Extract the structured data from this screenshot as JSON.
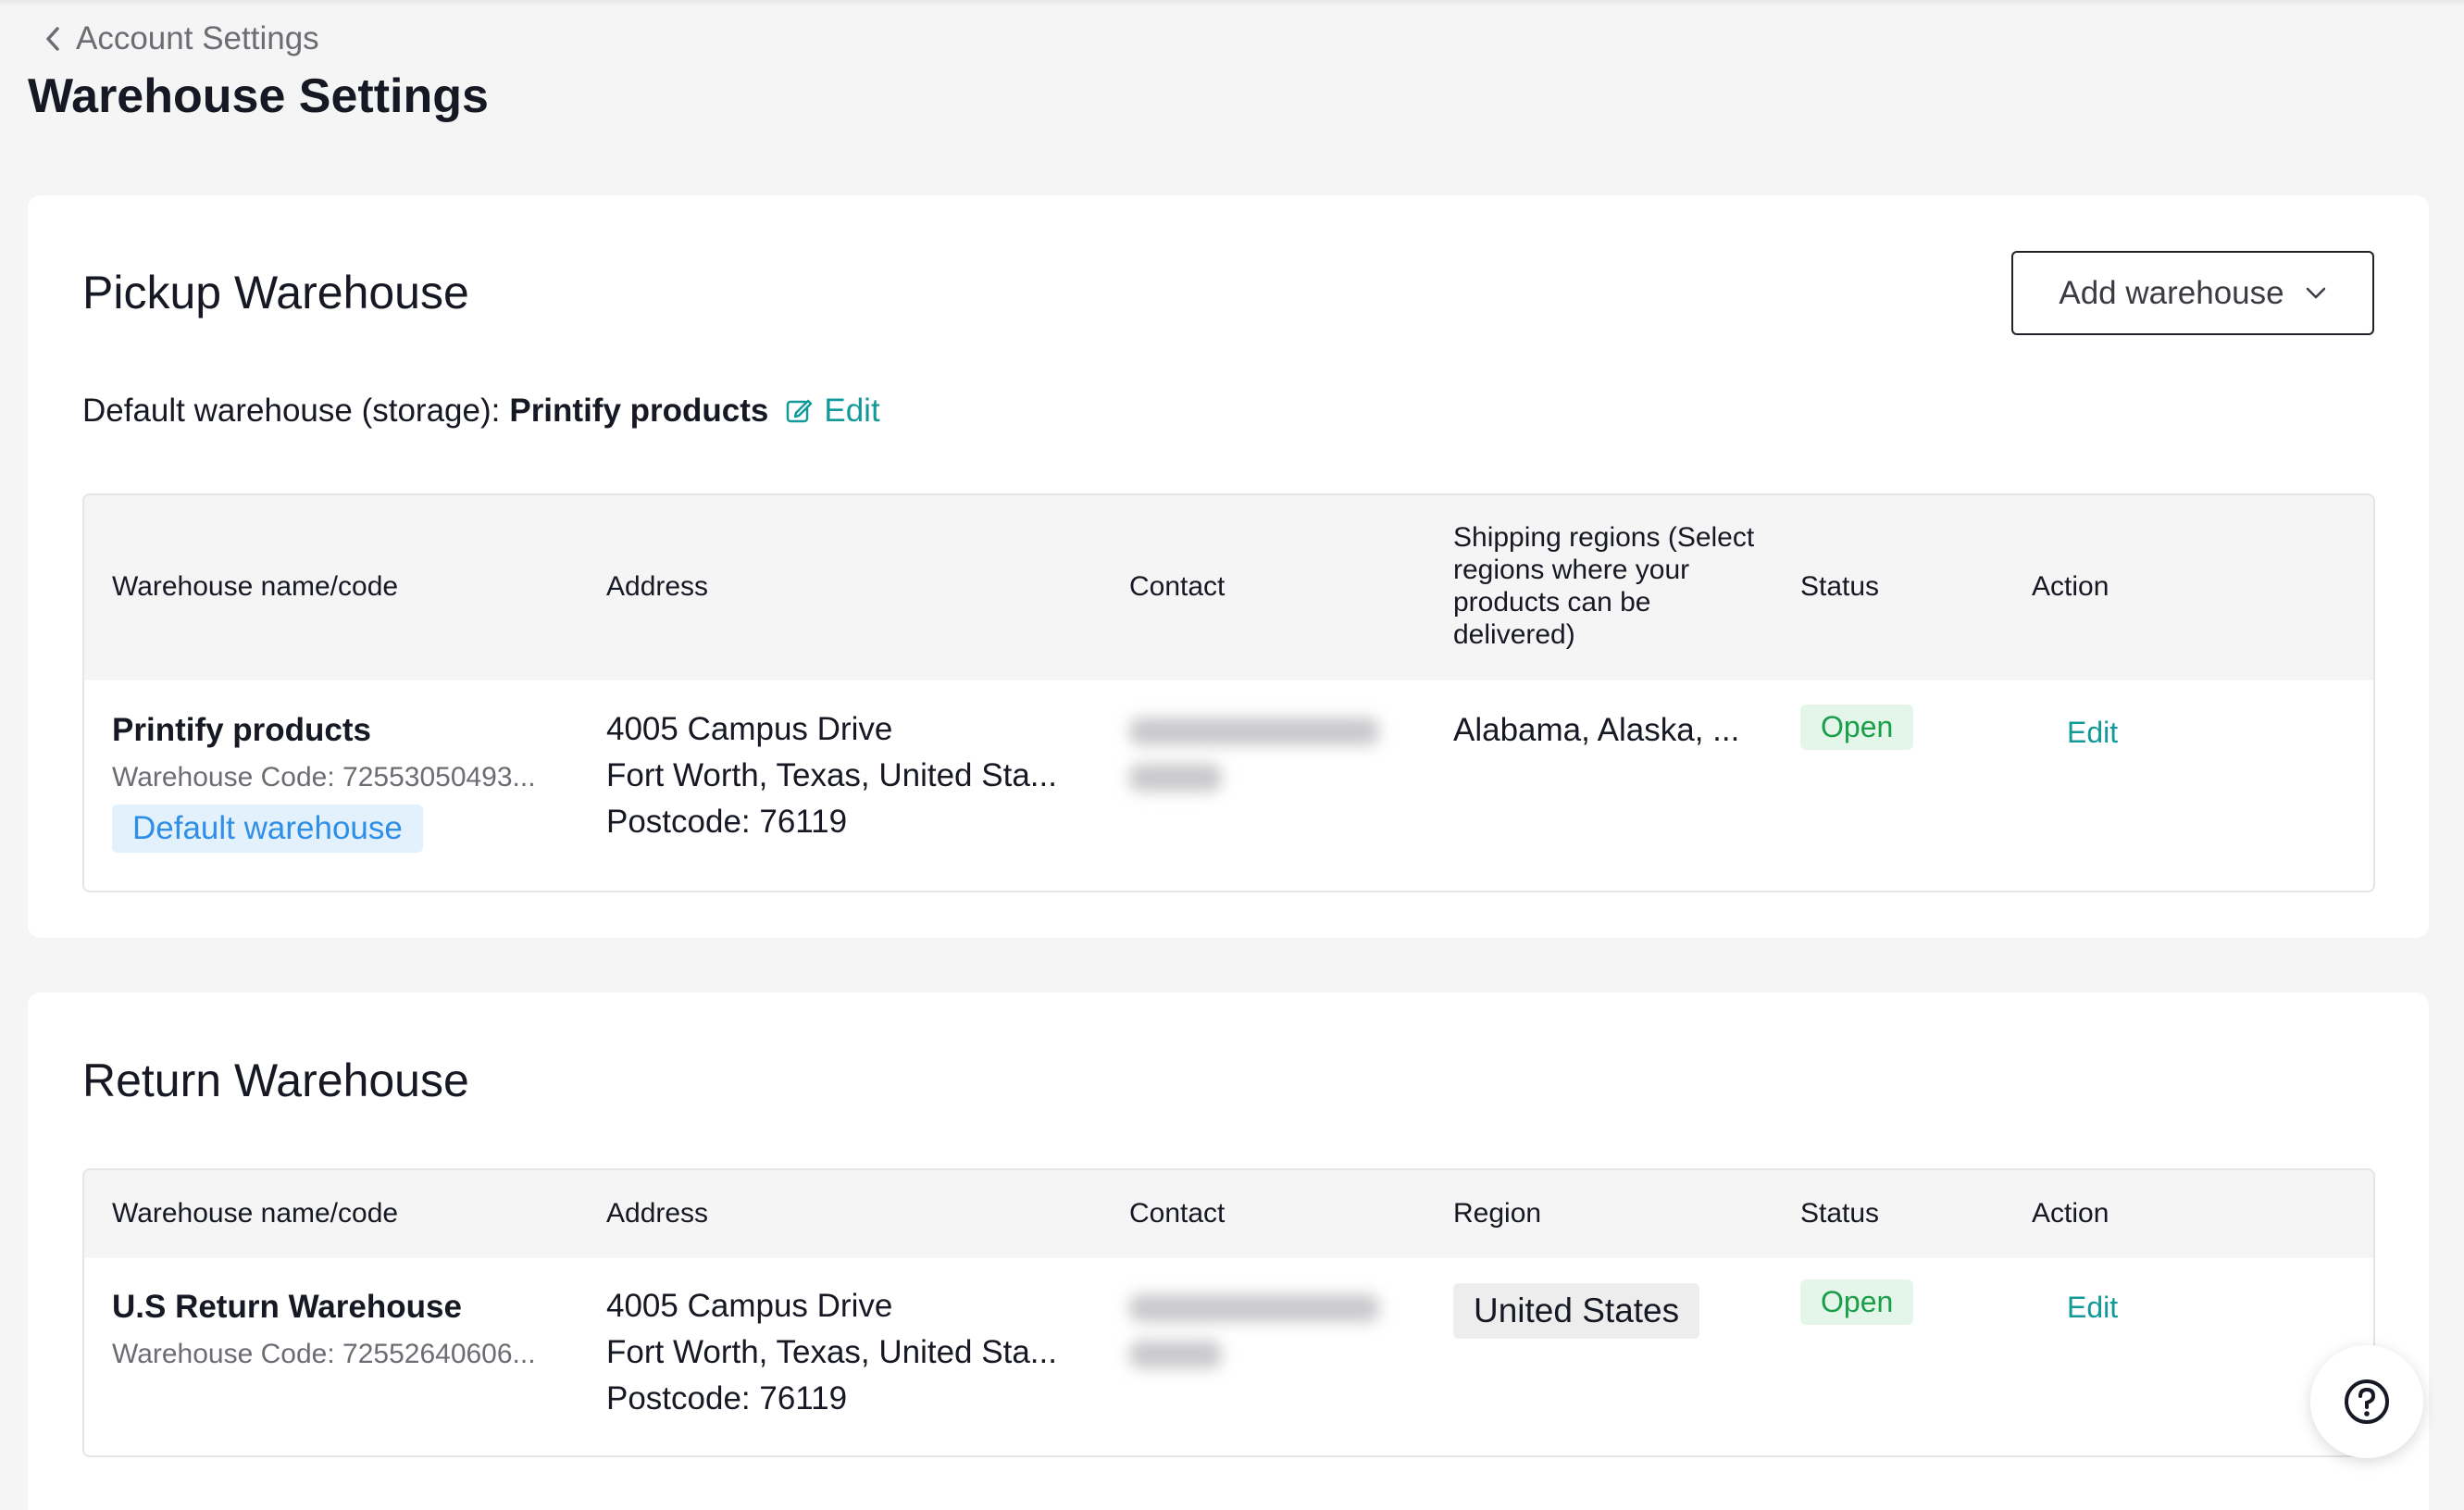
{
  "breadcrumb": {
    "back_label": "Account Settings"
  },
  "page": {
    "title": "Warehouse Settings"
  },
  "pickup": {
    "title": "Pickup Warehouse",
    "add_button": "Add warehouse",
    "default_prefix": "Default warehouse (storage):",
    "default_name": "Printify products",
    "edit_label": "Edit",
    "columns": {
      "name": "Warehouse name/code",
      "address": "Address",
      "contact": "Contact",
      "shipping": "Shipping regions (Select regions where your products can be delivered)",
      "status": "Status",
      "action": "Action"
    },
    "rows": [
      {
        "name": "Printify products",
        "code": "Warehouse Code: 72553050493...",
        "badge": "Default warehouse",
        "address_line1": "4005 Campus Drive",
        "address_line2": "Fort Worth, Texas, United Sta...",
        "postcode": "Postcode: 76119",
        "regions": "Alabama, Alaska, ...",
        "status": "Open",
        "action": "Edit"
      }
    ]
  },
  "return": {
    "title": "Return Warehouse",
    "columns": {
      "name": "Warehouse name/code",
      "address": "Address",
      "contact": "Contact",
      "region": "Region",
      "status": "Status",
      "action": "Action"
    },
    "rows": [
      {
        "name": "U.S Return Warehouse",
        "code": "Warehouse Code: 72552640606...",
        "address_line1": "4005 Campus Drive",
        "address_line2": "Fort Worth, Texas, United Sta...",
        "postcode": "Postcode: 76119",
        "region": "United States",
        "status": "Open",
        "action": "Edit"
      }
    ]
  },
  "icons": {
    "back": "chevron-left-icon",
    "dropdown": "chevron-down-icon",
    "edit": "edit-icon",
    "help": "help-icon"
  },
  "colors": {
    "accent_teal": "#12999a",
    "open_green": "#1a9e48",
    "default_blue": "#2f8ee6"
  }
}
